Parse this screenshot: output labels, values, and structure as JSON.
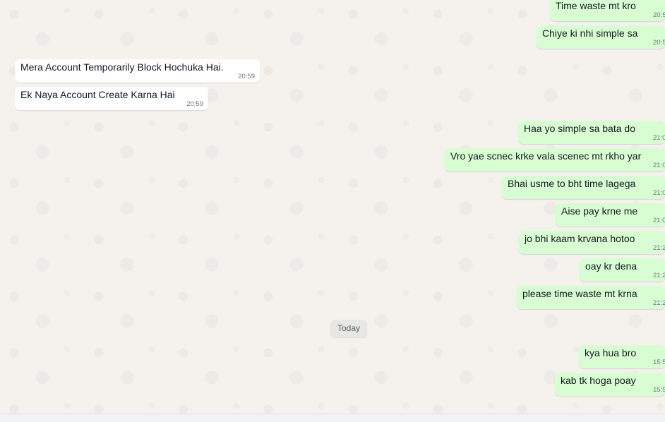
{
  "date_separator": "Today",
  "messages": [
    {
      "dir": "out",
      "text": "Time waste mt kro",
      "time": "20:5"
    },
    {
      "dir": "out",
      "text": "Chiye ki nhi simple sa",
      "time": "20:5"
    },
    {
      "dir": "in",
      "text": "Mera Account Temporarily Block Hochuka Hai.",
      "time": "20:59"
    },
    {
      "dir": "in",
      "text": "Ek Naya Account Create Karna Hai",
      "time": "20:59"
    },
    {
      "dir": "out",
      "text": "Haa  yo simple sa bata do",
      "time": "21:0"
    },
    {
      "dir": "out",
      "text": "Vro yae scnec krke vala scenec mt rkho yar",
      "time": "21:0"
    },
    {
      "dir": "out",
      "text": "Bhai usme to bht time lagega",
      "time": "21:0"
    },
    {
      "dir": "out",
      "text": "Aise pay krne me",
      "time": "21:0"
    },
    {
      "dir": "out",
      "text": "jo bhi kaam krvana hotoo",
      "time": "21:2"
    },
    {
      "dir": "out",
      "text": "oay kr dena",
      "time": "21:2"
    },
    {
      "dir": "out",
      "text": "please time waste mt krna",
      "time": "21:2"
    },
    {
      "dir": "out",
      "text": "kya hua bro",
      "time": "15:5"
    },
    {
      "dir": "out",
      "text": "kab tk hoga poay",
      "time": "15:5"
    }
  ]
}
